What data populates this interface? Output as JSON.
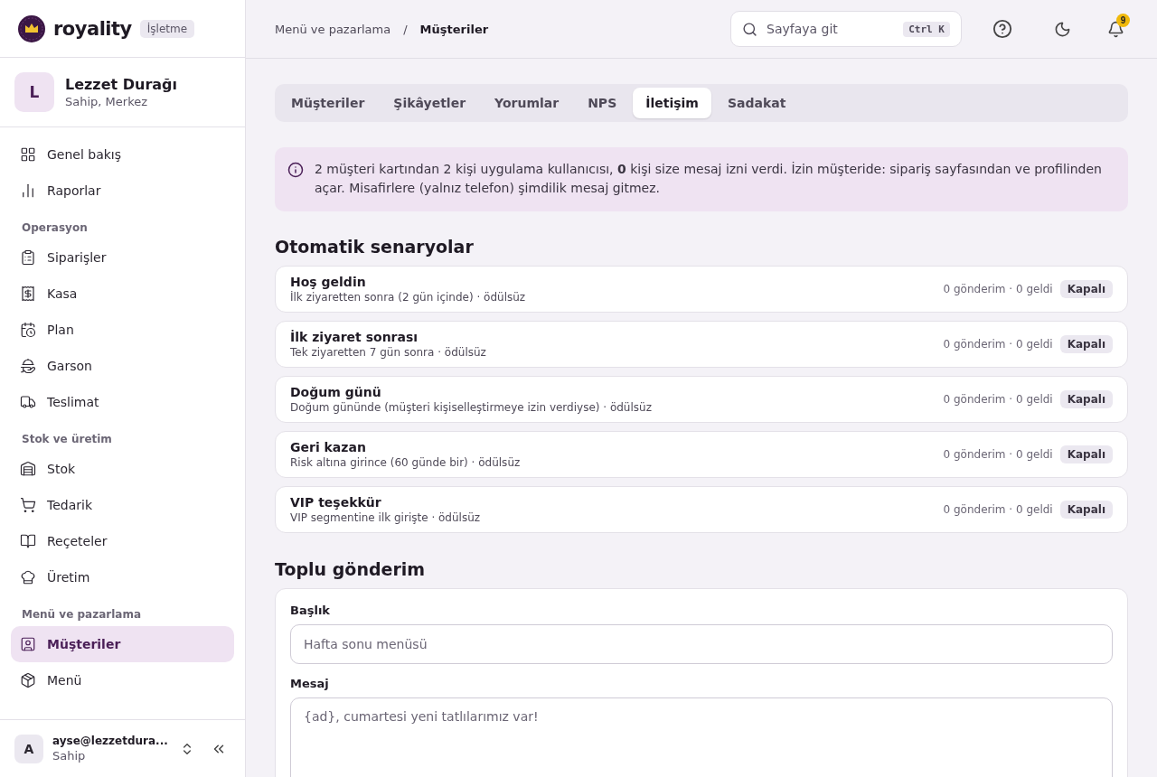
{
  "brand": {
    "name": "royality",
    "badge": "İşletme"
  },
  "business": {
    "initial": "L",
    "name": "Lezzet Durağı",
    "role": "Sahip, Merkez"
  },
  "sidebar": {
    "sections": [
      {
        "items": [
          {
            "label": "Genel bakış",
            "selected": false
          },
          {
            "label": "Raporlar",
            "selected": false
          }
        ]
      },
      {
        "title": "Operasyon",
        "items": [
          {
            "label": "Siparişler",
            "selected": false
          },
          {
            "label": "Kasa",
            "selected": false
          },
          {
            "label": "Plan",
            "selected": false
          },
          {
            "label": "Garson",
            "selected": false
          },
          {
            "label": "Teslimat",
            "selected": false
          }
        ]
      },
      {
        "title": "Stok ve üretim",
        "items": [
          {
            "label": "Stok",
            "selected": false
          },
          {
            "label": "Tedarik",
            "selected": false
          },
          {
            "label": "Reçeteler",
            "selected": false
          },
          {
            "label": "Üretim",
            "selected": false
          }
        ]
      },
      {
        "title": "Menü ve pazarlama",
        "items": [
          {
            "label": "Müşteriler",
            "selected": true
          },
          {
            "label": "Menü",
            "selected": false
          }
        ]
      }
    ]
  },
  "user": {
    "initial": "A",
    "email": "ayse@lezzetdura...",
    "role": "Sahip"
  },
  "breadcrumb": [
    "Menü ve pazarlama",
    "Müşteriler"
  ],
  "breadcrumb_separator": "/",
  "search": {
    "placeholder": "Sayfaya git",
    "shortcut": "Ctrl K"
  },
  "notifications": {
    "count": "9"
  },
  "tabs": [
    {
      "label": "Müşteriler",
      "selected": false
    },
    {
      "label": "Şikâyetler",
      "selected": false
    },
    {
      "label": "Yorumlar",
      "selected": false
    },
    {
      "label": "NPS",
      "selected": false
    },
    {
      "label": "İletişim",
      "selected": true
    },
    {
      "label": "Sadakat",
      "selected": false
    }
  ],
  "notice": "2 müşteri kartından 2 kişi uygulama kullanıcısı, **0** kişi size mesaj izni verdi. İzin müşteride: sipariş sayfasından ve profilinden açar. Misafirlere (yalnız telefon) şimdilik mesaj gitmez.",
  "scenarios": {
    "title": "Otomatik senaryolar",
    "items": [
      {
        "name": "Hoş geldin",
        "description": "İlk ziyaretten sonra (2 gün içinde) · ödülsüz",
        "stats": "0 gönderim · 0 geldi",
        "status": "Kapalı",
        "on": false
      },
      {
        "name": "İlk ziyaret sonrası",
        "description": "Tek ziyaretten 7 gün sonra · ödülsüz",
        "stats": "0 gönderim · 0 geldi",
        "status": "Kapalı",
        "on": false
      },
      {
        "name": "Doğum günü",
        "description": "Doğum gününde (müşteri kişiselleştirmeye izin verdiyse) · ödülsüz",
        "stats": "0 gönderim · 0 geldi",
        "status": "Kapalı",
        "on": false
      },
      {
        "name": "Geri kazan",
        "description": "Risk altına girince (60 günde bir) · ödülsüz",
        "stats": "0 gönderim · 0 geldi",
        "status": "Kapalı",
        "on": false
      },
      {
        "name": "VIP teşekkür",
        "description": "VIP segmentine ilk girişte · ödülsüz",
        "stats": "0 gönderim · 0 geldi",
        "status": "Kapalı",
        "on": false
      }
    ]
  },
  "broadcast": {
    "title": "Toplu gönderim",
    "fields": [
      {
        "label": "Başlık",
        "placeholder": "Hafta sonu menüsü",
        "kind": "input"
      },
      {
        "label": "Mesaj",
        "placeholder": "{ad}, cumartesi yeni tatlılarımız var!",
        "kind": "textarea"
      }
    ]
  }
}
